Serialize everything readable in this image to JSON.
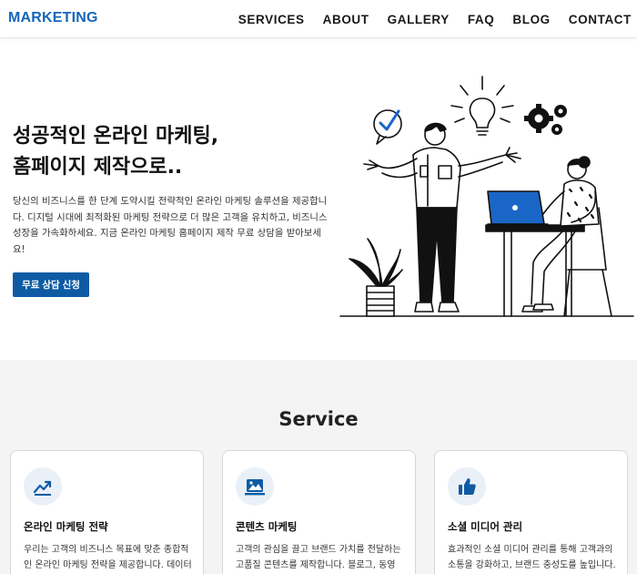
{
  "nav": {
    "logo": "MARKETING",
    "items": [
      {
        "label": "SERVICES"
      },
      {
        "label": "ABOUT"
      },
      {
        "label": "GALLERY"
      },
      {
        "label": "FAQ"
      },
      {
        "label": "BLOG"
      },
      {
        "label": "CONTACT"
      }
    ]
  },
  "hero": {
    "title_line1": "성공적인 온라인 마케팅,",
    "title_line2": "홈페이지 제작으로..",
    "description": "당신의 비즈니스를 한 단계 도약시킬 전략적인 온라인 마케팅 솔루션을 제공합니다. 디지털 시대에 최적화된 마케팅 전략으로 더 많은 고객을 유치하고, 비즈니스 성장을 가속화하세요. 지금 온라인 마케팅 홈페이지 제작 무료 상담을 받아보세요!",
    "cta_label": "무료 상담 신청"
  },
  "services": {
    "heading": "Service",
    "cards": [
      {
        "icon": "chart-trend-icon",
        "title": "온라인 마케팅 전략",
        "text": "우리는 고객의 비즈니스 목표에 맞춘 종합적인 온라인 마케팅 전략을 제공합니다. 데이터"
      },
      {
        "icon": "media-icon",
        "title": "콘텐츠 마케팅",
        "text": "고객의 관심을 끌고 브랜드 가치를 전달하는 고품질 콘텐츠를 제작합니다. 블로그, 동영"
      },
      {
        "icon": "thumbs-up-icon",
        "title": "소셜 미디어 관리",
        "text": "효과적인 소셜 미디어 관리를 통해 고객과의 소통을 강화하고, 브랜드 충성도를 높입니다."
      }
    ]
  },
  "colors": {
    "brand": "#1666b8",
    "cta": "#0e5ba3",
    "laptop": "#1a66c6",
    "section_bg": "#f4f4f4"
  }
}
